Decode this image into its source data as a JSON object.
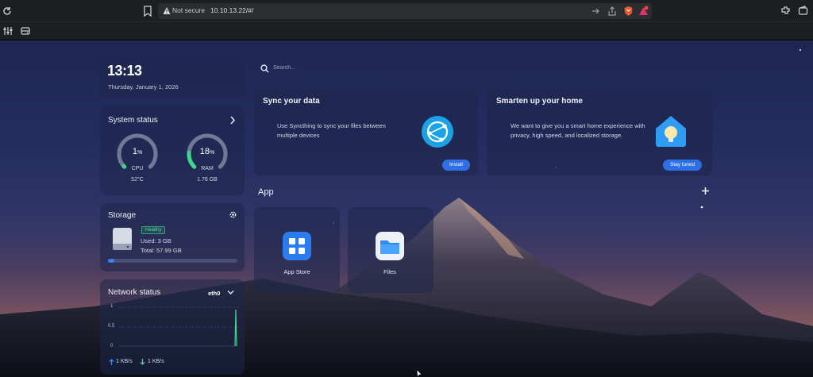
{
  "browser": {
    "security_label": "Not secure",
    "url": "10.10.13.22/#/"
  },
  "clock": {
    "time": "13:13",
    "date": "Thursday, January 1, 2026"
  },
  "system_status": {
    "title": "System status",
    "cpu": {
      "value": "1",
      "unit": "%",
      "label": "CPU",
      "detail": "52°C",
      "percent": 1
    },
    "ram": {
      "value": "18",
      "unit": "%",
      "label": "RAM",
      "detail": "1.76 GB",
      "percent": 18
    }
  },
  "storage": {
    "title": "Storage",
    "health": "Healthy",
    "used": "Used: 3 GB",
    "total": "Total: 57.99 GB",
    "used_fraction": 0.052
  },
  "network": {
    "title": "Network status",
    "interface": "eth0",
    "y_ticks": [
      "1",
      "0.5",
      "0"
    ],
    "upload": "1 KB/s",
    "download": "1 KB/s"
  },
  "search": {
    "placeholder": "Search..."
  },
  "sync_card": {
    "title": "Sync your data",
    "description": "Use Syncthing to sync your files between multiple devices",
    "button": "Install"
  },
  "home_card": {
    "title": "Smarten up your home",
    "description": "We want to give you a smart home experience with privacy, high speed, and localized storage.",
    "button": "Stay tuned"
  },
  "apps": {
    "title": "App",
    "items": [
      {
        "label": "App Store"
      },
      {
        "label": "Files"
      }
    ]
  },
  "colors": {
    "accent": "#2f6fe6",
    "gauge_fill": "#3fd78f",
    "healthy": "#4fe0a8"
  }
}
